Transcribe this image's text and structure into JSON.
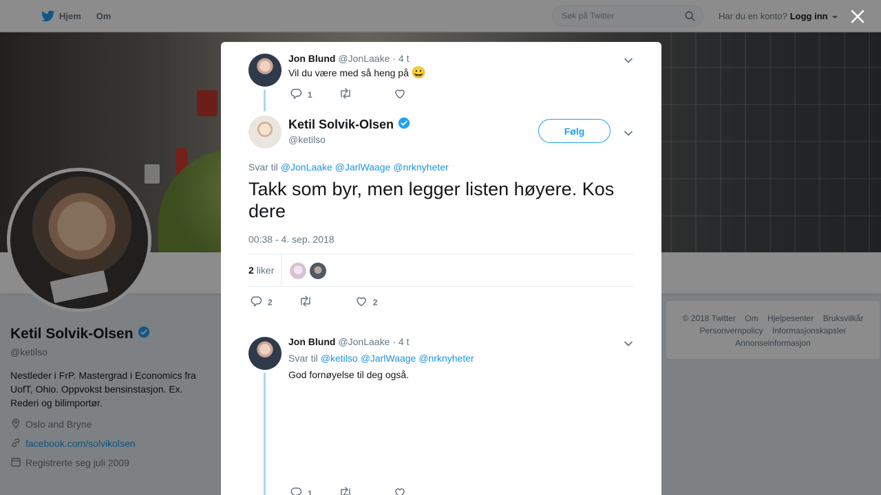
{
  "topbar": {
    "home_label": "Hjem",
    "about_label": "Om",
    "search_placeholder": "Søk på Twitter",
    "account_prompt": "Har du en konto?",
    "login_label": "Logg inn"
  },
  "profile": {
    "name": "Ketil Solvik-Olsen",
    "handle": "@ketilso",
    "bio": "Nestleder i FrP. Mastergrad i Economics fra UofT, Ohio. Oppvokst bensinstasjon. Ex. Rederi og bilimportør.",
    "location": "Oslo and Bryne",
    "website": "facebook.com/solvikolsen",
    "joined": "Registrerte seg juli 2009"
  },
  "footer": {
    "links": [
      "© 2018 Twitter",
      "Om",
      "Hjelpesenter",
      "Bruksvilkår",
      "Personvernpolicy",
      "Informasjonskapsler",
      "Annonseinformasjon"
    ]
  },
  "modal": {
    "parent_tweet": {
      "name": "Jon Blund",
      "handle": "@JonLaake",
      "time": "· 4 t",
      "text": "Vil du være med så heng på",
      "emoji": "😀",
      "reply_count": "1"
    },
    "main_tweet": {
      "name": "Ketil Solvik-Olsen",
      "handle": "@ketilso",
      "follow_label": "Følg",
      "reply_prefix": "Svar til",
      "mentions": [
        "@JonLaake",
        "@JarlWaage",
        "@nrknyheter"
      ],
      "text": "Takk som byr, men legger listen høyere. Kos dere",
      "timestamp": "00:38 - 4. sep. 2018",
      "likes_count": "2",
      "likes_label": "liker",
      "reply_count": "2",
      "like_count": "2"
    },
    "reply_tweet": {
      "name": "Jon Blund",
      "handle": "@JonLaake",
      "time": "· 4 t",
      "reply_prefix": "Svar til",
      "mentions": [
        "@ketilso",
        "@JarlWaage",
        "@nrknyheter"
      ],
      "text": "God fornøyelse til deg også.",
      "reply_count": "1"
    }
  },
  "colors": {
    "accent": "#1da1f2",
    "link": "#1b95e0",
    "muted": "#657786",
    "thread_line": "#a7d8ee"
  }
}
